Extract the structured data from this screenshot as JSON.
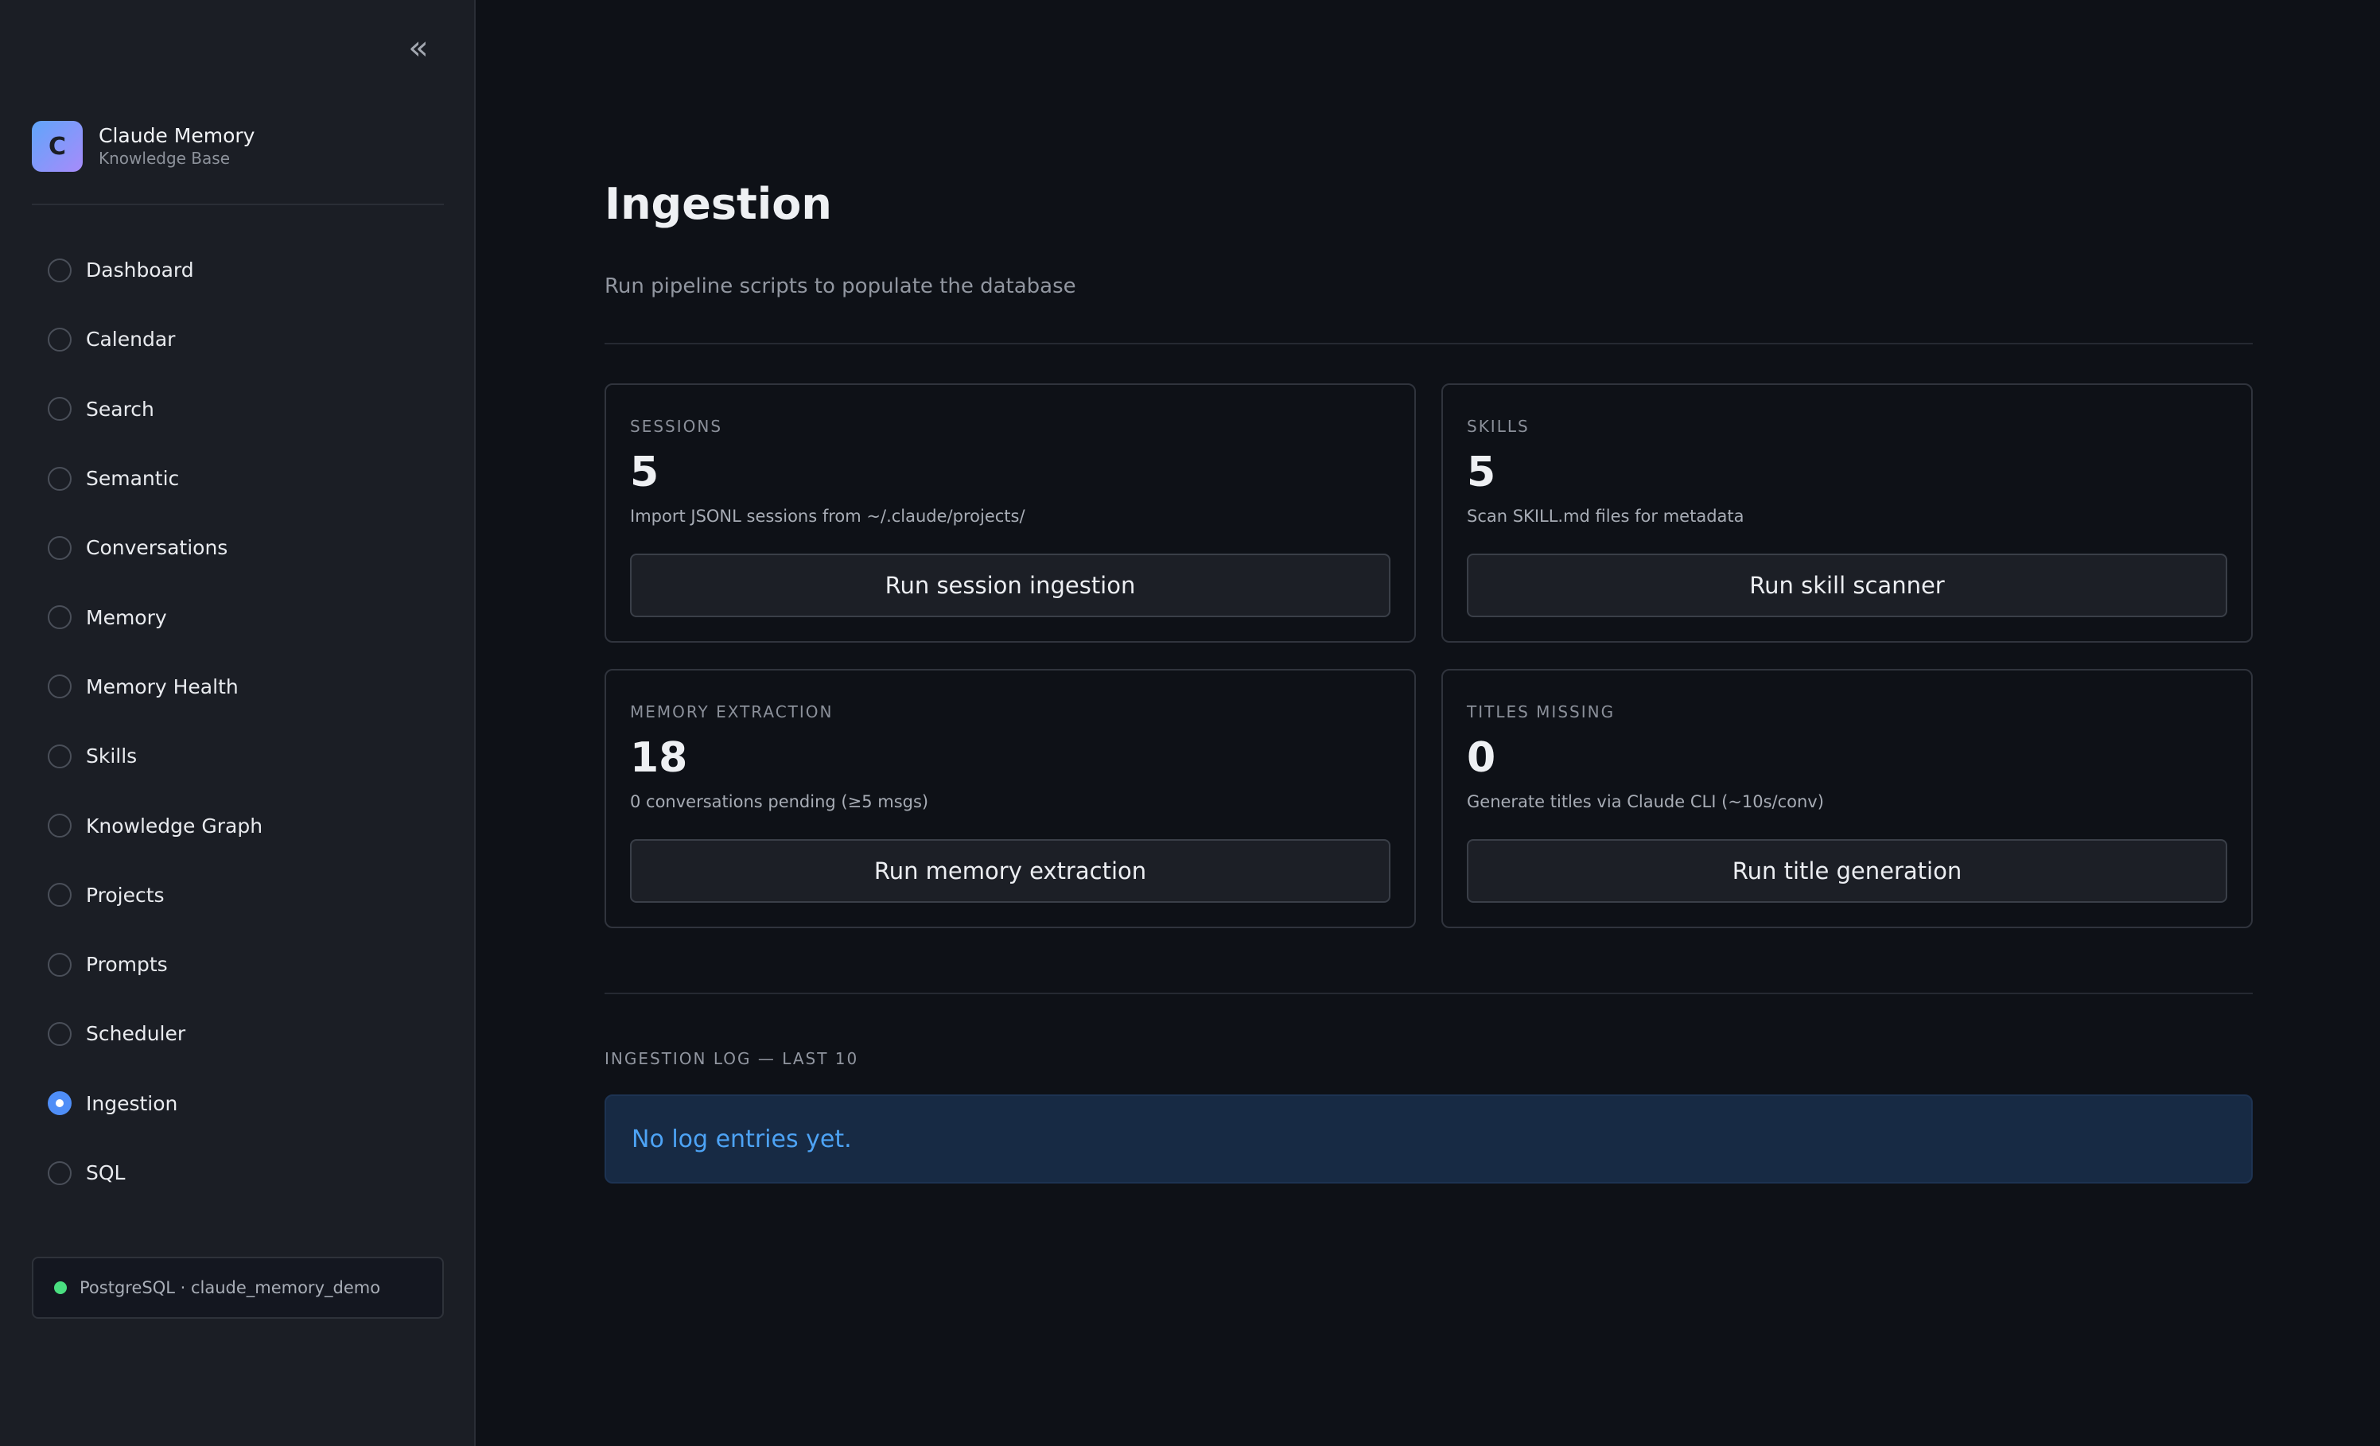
{
  "sidebar": {
    "brand": {
      "logo_letter": "C",
      "title": "Claude Memory",
      "subtitle": "Knowledge Base"
    },
    "nav_items": [
      {
        "label": "Dashboard",
        "selected": false
      },
      {
        "label": "Calendar",
        "selected": false
      },
      {
        "label": "Search",
        "selected": false
      },
      {
        "label": "Semantic",
        "selected": false
      },
      {
        "label": "Conversations",
        "selected": false
      },
      {
        "label": "Memory",
        "selected": false
      },
      {
        "label": "Memory Health",
        "selected": false
      },
      {
        "label": "Skills",
        "selected": false
      },
      {
        "label": "Knowledge Graph",
        "selected": false
      },
      {
        "label": "Projects",
        "selected": false
      },
      {
        "label": "Prompts",
        "selected": false
      },
      {
        "label": "Scheduler",
        "selected": false
      },
      {
        "label": "Ingestion",
        "selected": true
      },
      {
        "label": "SQL",
        "selected": false
      }
    ],
    "db_status": {
      "label": "PostgreSQL · claude_memory_demo",
      "status_color": "#4ade80"
    }
  },
  "main": {
    "title": "Ingestion",
    "subtitle": "Run pipeline scripts to populate the database",
    "cards": [
      {
        "label": "SESSIONS",
        "value": "5",
        "description": "Import JSONL sessions from ~/.claude/projects/",
        "button": "Run session ingestion"
      },
      {
        "label": "SKILLS",
        "value": "5",
        "description": "Scan SKILL.md files for metadata",
        "button": "Run skill scanner"
      },
      {
        "label": "MEMORY EXTRACTION",
        "value": "18",
        "description": "0 conversations pending (≥5 msgs)",
        "button": "Run memory extraction"
      },
      {
        "label": "TITLES MISSING",
        "value": "0",
        "description": "Generate titles via Claude CLI (~10s/conv)",
        "button": "Run title generation"
      }
    ],
    "log": {
      "heading": "INGESTION LOG — LAST 10",
      "empty_message": "No log entries yet."
    }
  },
  "colors": {
    "background": "#0e1117",
    "sidebar": "#1b1e25",
    "accent": "#4f8ef7",
    "info_box": "#172a44",
    "info_text": "#4da3f5"
  }
}
